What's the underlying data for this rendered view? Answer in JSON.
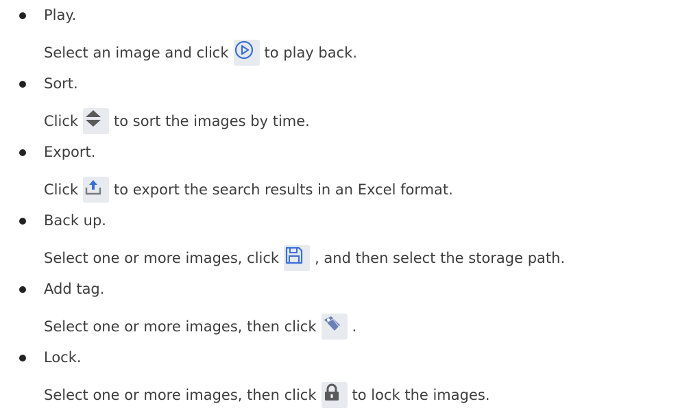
{
  "items": [
    {
      "title": "Play.",
      "desc_before": "Select an image and click",
      "icon": "play-circle-icon",
      "desc_after": " to play back."
    },
    {
      "title": "Sort.",
      "desc_before": "Click",
      "icon": "sort-arrows-icon",
      "desc_after": " to sort the images by time."
    },
    {
      "title": "Export.",
      "desc_before": "Click",
      "icon": "export-upload-icon",
      "desc_after": " to export the search results in an Excel format."
    },
    {
      "title": "Back up.",
      "desc_before": "Select one or more images, click",
      "icon": "save-disk-icon",
      "desc_after": ", and then select the storage path."
    },
    {
      "title": "Add tag.",
      "desc_before": "Select one or more images, then click",
      "icon": "tag-icon",
      "desc_after": "."
    },
    {
      "title": "Lock.",
      "desc_before": "Select one or more images, then click",
      "icon": "lock-icon",
      "desc_after": " to lock the images."
    }
  ],
  "colors": {
    "text": "#3d3d3d",
    "icon_bg": "#e7eaef",
    "icon_blue": "#3a6fd8",
    "icon_gray": "#5a5a5a",
    "tag_blue": "#6b7fb8"
  }
}
